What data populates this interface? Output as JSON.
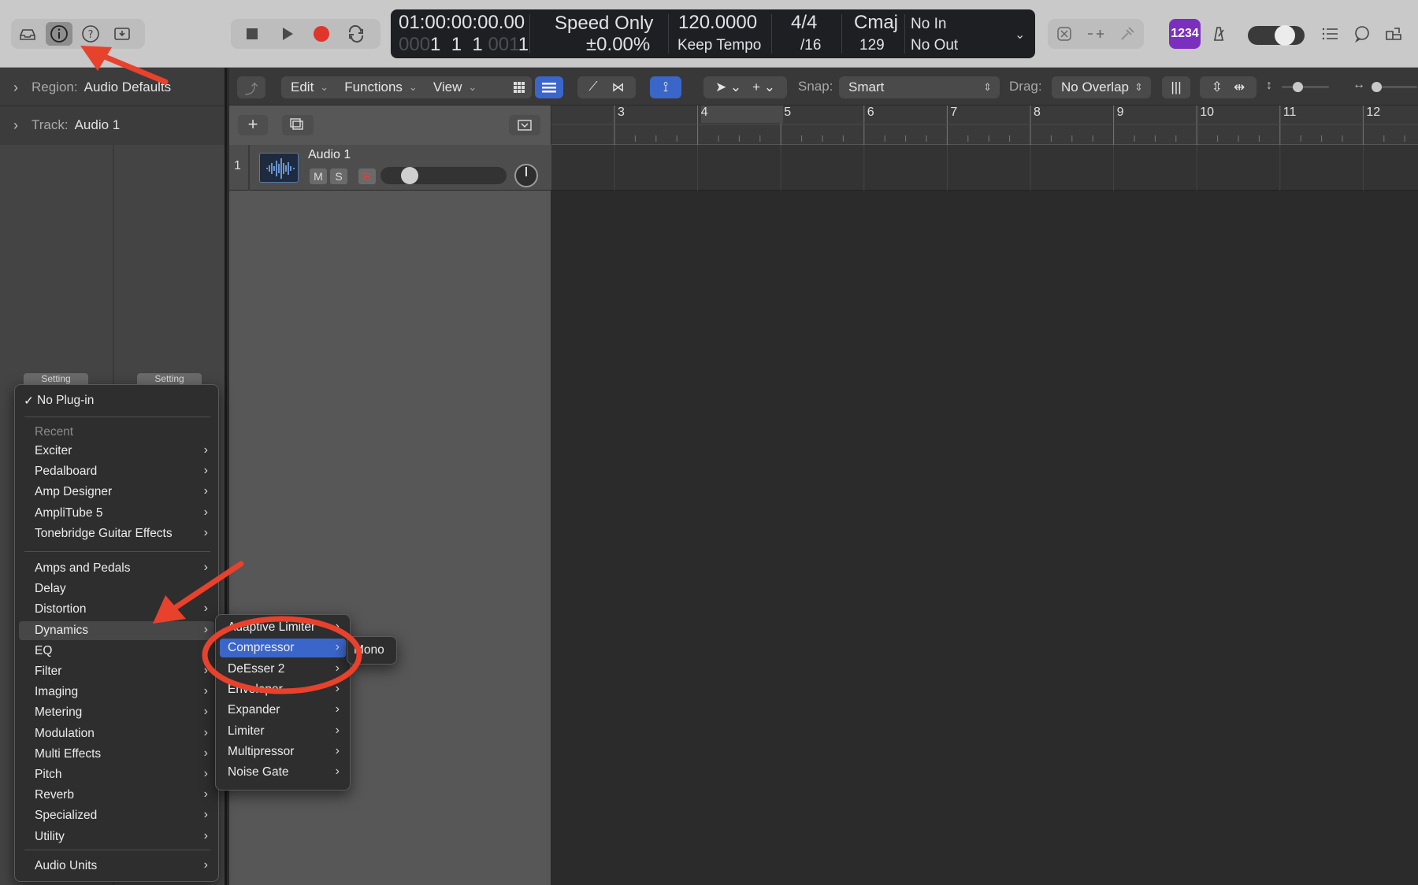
{
  "control_bar": {
    "left_buttons": [
      {
        "name": "library-icon"
      },
      {
        "name": "inspector-icon",
        "active": true
      },
      {
        "name": "quick-help-icon"
      },
      {
        "name": "toolbar-icon"
      }
    ],
    "transport": [
      "stop-icon",
      "play-icon",
      "record-icon",
      "cycle-icon"
    ],
    "lcd": {
      "timecode": "01:00:00:00.00",
      "position_dim": "000",
      "position_bars": "1  1  1",
      "position_dim2": "001",
      "position_tick": "1",
      "sync_mode": "Speed Only",
      "varispeed": "±0.00",
      "varispeed_unit": "%",
      "tempo": "120.0000",
      "tempo_mode": "Keep Tempo",
      "signature": "4/4",
      "division": "/16",
      "key": "Cmaj",
      "key_value": "129",
      "midi_in": "No In",
      "midi_out": "No Out"
    },
    "right_badge": "1234"
  },
  "inspector": {
    "region_label": "Region:",
    "region_value": "Audio Defaults",
    "track_label": "Track:",
    "track_value": "Audio 1",
    "setting_left": "Setting",
    "setting_right": "Setting"
  },
  "tracks_toolbar": {
    "edit": "Edit",
    "functions": "Functions",
    "view": "View",
    "snap_label": "Snap:",
    "snap_value": "Smart",
    "drag_label": "Drag:",
    "drag_value": "No Overlap"
  },
  "track": {
    "number": "1",
    "name": "Audio 1",
    "mute": "M",
    "solo": "S",
    "record": "R"
  },
  "ruler": {
    "bars": [
      "3",
      "4",
      "5",
      "6",
      "7",
      "8",
      "9",
      "10",
      "11",
      "12"
    ]
  },
  "plugin_menu": {
    "no_plugin": "No Plug-in",
    "recent_header": "Recent",
    "recent": [
      "Exciter",
      "Pedalboard",
      "Amp Designer",
      "AmpliTube 5",
      "Tonebridge Guitar Effects"
    ],
    "categories": [
      "Amps and Pedals",
      "Delay",
      "Distortion",
      "Dynamics",
      "EQ",
      "Filter",
      "Imaging",
      "Metering",
      "Modulation",
      "Multi Effects",
      "Pitch",
      "Reverb",
      "Specialized",
      "Utility"
    ],
    "audio_units": "Audio Units"
  },
  "dynamics_menu": {
    "items": [
      "Adaptive Limiter",
      "Compressor",
      "DeEsser 2",
      "Enveloper",
      "Expander",
      "Limiter",
      "Multipressor",
      "Noise Gate"
    ]
  },
  "compressor_menu": {
    "items": [
      "Mono"
    ]
  },
  "colors": {
    "accent": "#3b66c9",
    "annotation": "#e8412c",
    "record": "#e0352b",
    "badge": "#7b2fbf"
  }
}
